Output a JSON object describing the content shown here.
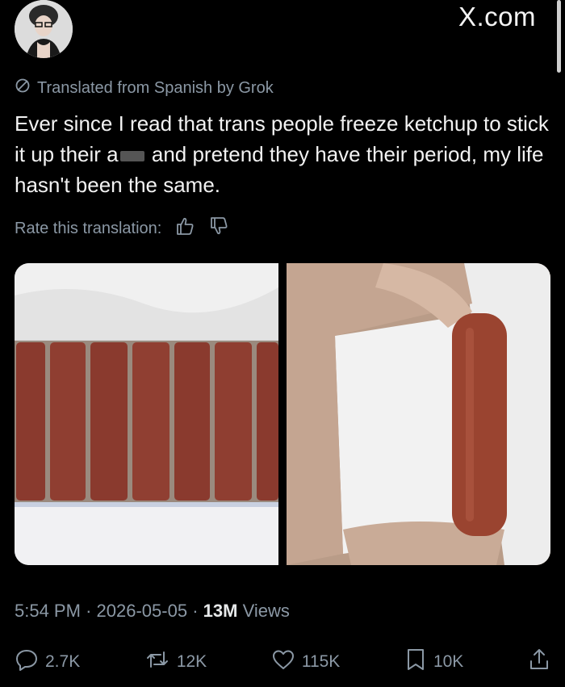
{
  "header": {
    "watermark": "X.com"
  },
  "translation": {
    "label": "Translated from Spanish by Grok"
  },
  "tweet": {
    "text_part1": "Ever since I read that trans people freeze ketchup to stick it up their a",
    "text_part2": " and pretend they have their period, my life hasn't been the same."
  },
  "rate": {
    "label": "Rate this translation:"
  },
  "meta": {
    "time": "5:54 PM",
    "date": "2026-05-05",
    "views_count": "13M",
    "views_label": "Views"
  },
  "actions": {
    "replies": "2.7K",
    "reposts": "12K",
    "likes": "115K",
    "bookmarks": "10K"
  },
  "colors": {
    "background": "#000000",
    "text": "#e7e9ea",
    "muted": "#8b98a5"
  }
}
